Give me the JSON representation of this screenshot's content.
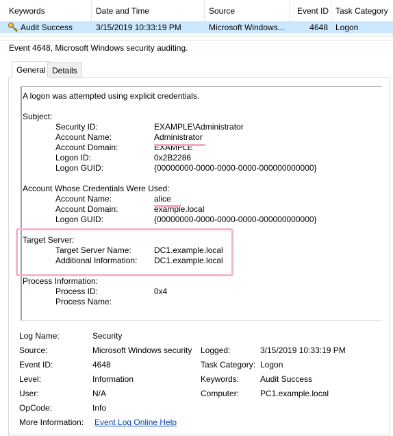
{
  "list": {
    "headers": [
      "Keywords",
      "Date and Time",
      "Source",
      "Event ID",
      "Task Category"
    ],
    "row": {
      "keyword": "Audit Success",
      "datetime": "3/15/2019 10:33:19 PM",
      "source": "Microsoft Windows...",
      "event_id": "4648",
      "task_category": "Logon"
    }
  },
  "event_title": "Event 4648, Microsoft Windows security auditing.",
  "tabs": [
    "General",
    "Details"
  ],
  "message": {
    "intro": "A logon was attempted using explicit credentials.",
    "subject_heading": "Subject:",
    "subject": [
      {
        "label": "Security ID:",
        "value": "EXAMPLE\\Administrator"
      },
      {
        "label": "Account Name:",
        "value": "Administrator"
      },
      {
        "label": "Account Domain:",
        "value": "EXAMPLE"
      },
      {
        "label": "Logon ID:",
        "value": "0x2B2286"
      },
      {
        "label": "Logon GUID:",
        "value": "{00000000-0000-0000-0000-000000000000}"
      }
    ],
    "creds_heading": "Account Whose Credentials Were Used:",
    "creds": [
      {
        "label": "Account Name:",
        "value": "alice"
      },
      {
        "label": "Account Domain:",
        "value": "example.local"
      },
      {
        "label": "Logon GUID:",
        "value": "{00000000-0000-0000-0000-000000000000}"
      }
    ],
    "target_heading": "Target Server:",
    "target": [
      {
        "label": "Target Server Name:",
        "value": "DC1.example.local"
      },
      {
        "label": "Additional Information:",
        "value": "DC1.example.local"
      }
    ],
    "process_heading": "Process Information:",
    "process": [
      {
        "label": "Process ID:",
        "value": "0x4"
      },
      {
        "label": "Process Name:",
        "value": ""
      }
    ]
  },
  "details": {
    "log_name_label": "Log Name:",
    "log_name": "Security",
    "source_label": "Source:",
    "source": "Microsoft Windows security",
    "logged_label": "Logged:",
    "logged": "3/15/2019 10:33:19 PM",
    "event_id_label": "Event ID:",
    "event_id": "4648",
    "task_category_label": "Task Category:",
    "task_category": "Logon",
    "level_label": "Level:",
    "level": "Information",
    "keywords_label": "Keywords:",
    "keywords": "Audit Success",
    "user_label": "User:",
    "user": "N/A",
    "computer_label": "Computer:",
    "computer": "PC1.example.local",
    "opcode_label": "OpCode:",
    "opcode": "Info",
    "more_info_label": "More Information:",
    "more_info_link": "Event Log Online Help"
  },
  "colors": {
    "selected_row": "#cce8ff",
    "highlight": "#f4b5cf",
    "link": "#0645ad"
  }
}
